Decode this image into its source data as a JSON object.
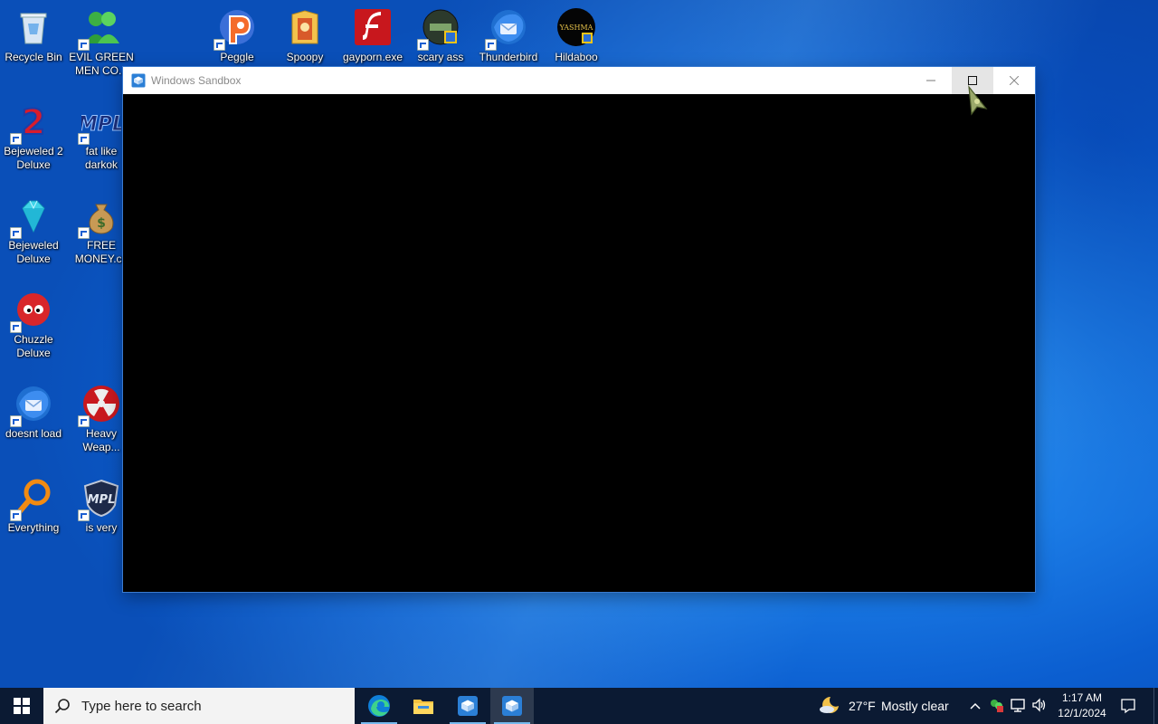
{
  "desktop": {
    "icons": [
      {
        "label": "Recycle Bin",
        "icon": "recycle-bin-icon"
      },
      {
        "label": "EVIL GREEN MEN CO...",
        "icon": "green-men-icon"
      },
      {
        "label": "Peggle",
        "icon": "peggle-icon"
      },
      {
        "label": "Spoopy",
        "icon": "folder-icon"
      },
      {
        "label": "gayporn.exe",
        "icon": "flash-icon"
      },
      {
        "label": "scary ass",
        "icon": "scary-icon"
      },
      {
        "label": "Thunderbird",
        "icon": "thunderbird-icon"
      },
      {
        "label": "Hildaboo",
        "icon": "yashma-icon"
      },
      {
        "label": "Bejeweled 2 Deluxe",
        "icon": "bejeweled2-icon"
      },
      {
        "label": "fat like darkok",
        "icon": "mpl-icon"
      },
      {
        "label": "Bejeweled Deluxe",
        "icon": "gem-icon"
      },
      {
        "label": "FREE MONEY.co",
        "icon": "money-bag-icon"
      },
      {
        "label": "Chuzzle Deluxe",
        "icon": "chuzzle-icon"
      },
      {
        "label": "doesnt load",
        "icon": "thunderbird-icon"
      },
      {
        "label": "Heavy Weap...",
        "icon": "radiation-icon"
      },
      {
        "label": "Everything",
        "icon": "magnifier-icon"
      },
      {
        "label": "is very",
        "icon": "mpl-shield-icon"
      }
    ],
    "yashma_text": "YASHMA"
  },
  "window": {
    "title": "Windows Sandbox"
  },
  "taskbar": {
    "search_placeholder": "Type here to search",
    "weather_temp": "27°F",
    "weather_desc": "Mostly clear",
    "time": "1:17 AM",
    "date": "12/1/2024"
  },
  "colors": {
    "taskbar_bg": "#0b1a33",
    "accent": "#76b9ed",
    "window_title": "#8a8a8a"
  }
}
